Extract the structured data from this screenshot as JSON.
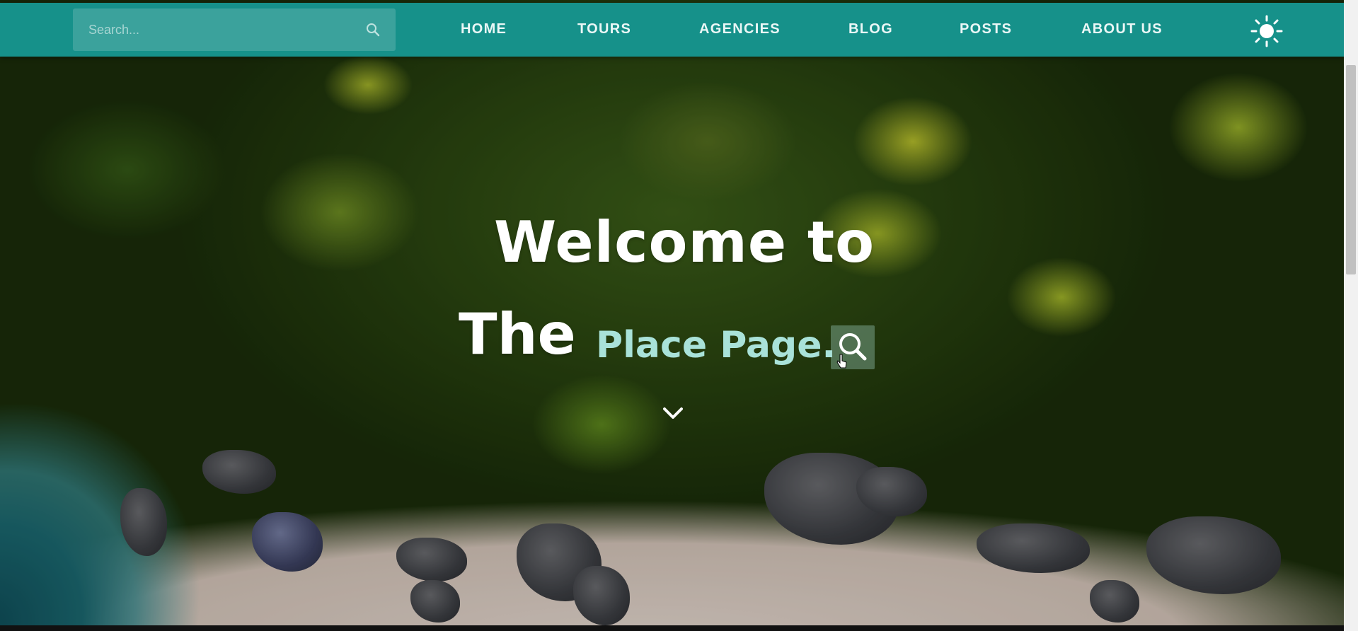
{
  "navbar": {
    "search": {
      "placeholder": "Search...",
      "icon": "search-icon"
    },
    "links": [
      {
        "label": "HOME"
      },
      {
        "label": "TOURS"
      },
      {
        "label": "AGENCIES"
      },
      {
        "label": "BLOG"
      },
      {
        "label": "POSTS"
      },
      {
        "label": "ABOUT US"
      }
    ],
    "theme_toggle_icon": "sun-icon",
    "background_color": "#16918a"
  },
  "hero": {
    "title_line_1": "Welcome to",
    "title_line_2": "The",
    "typed_text": "Place Page.",
    "typed_color": "#a9e2d9",
    "search_button_icon": "search-icon",
    "scroll_icon": "chevron-down-icon"
  }
}
